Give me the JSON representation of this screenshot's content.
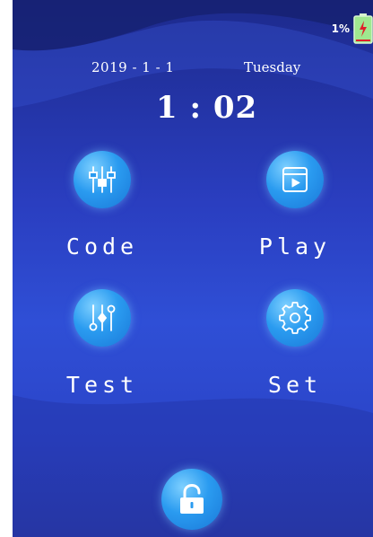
{
  "status": {
    "battery_percent": "1%",
    "battery_level": 0.01,
    "battery_icon": "battery-charging-icon"
  },
  "datetime": {
    "date": "2019 - 1 - 1",
    "weekday": "Tuesday",
    "time": "1 : 02"
  },
  "menu": {
    "code": {
      "label": "Code",
      "icon": "equalizer-icon"
    },
    "play": {
      "label": "Play",
      "icon": "play-window-icon"
    },
    "test": {
      "label": "Test",
      "icon": "sliders-icon"
    },
    "set": {
      "label": "Set",
      "icon": "gear-icon"
    }
  },
  "unlock": {
    "icon": "unlock-icon"
  },
  "colors": {
    "background_top": "#1d2a8c",
    "background_mid": "#2f4fd6",
    "icon_fill": "#2a9bf0",
    "text": "#ffffff",
    "battery_green": "#4cd964",
    "battery_red": "#e0202a"
  }
}
